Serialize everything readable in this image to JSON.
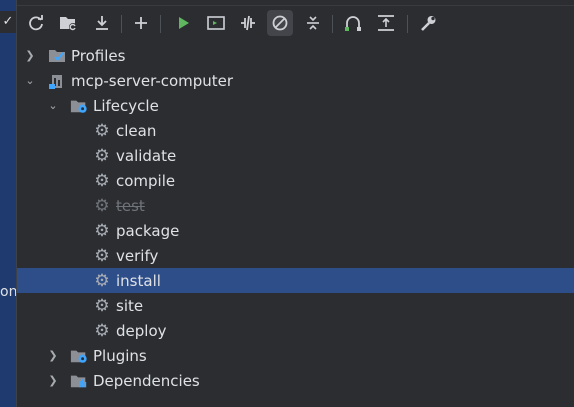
{
  "toolbar": {
    "buttons": [
      {
        "name": "reload-all-projects",
        "icon": "refresh-icon"
      },
      {
        "name": "generate-sources",
        "icon": "folder-refresh-icon"
      },
      {
        "name": "download-sources",
        "icon": "download-icon"
      },
      {
        "name": "add-maven-project",
        "icon": "plus-icon"
      },
      {
        "name": "run-maven-build",
        "icon": "run-icon"
      },
      {
        "name": "execute-maven-goal",
        "icon": "terminal-icon"
      },
      {
        "name": "toggle-offline-mode",
        "icon": "offline-icon"
      },
      {
        "name": "toggle-skip-tests",
        "icon": "skip-tests-icon"
      },
      {
        "name": "collapse-all",
        "icon": "collapse-icon"
      },
      {
        "name": "show-dependencies",
        "icon": "diagram-icon"
      },
      {
        "name": "expand-all",
        "icon": "expand-icon"
      },
      {
        "name": "maven-settings",
        "icon": "wrench-icon"
      }
    ]
  },
  "left": {
    "check": "✓",
    "text": "on"
  },
  "tree": {
    "profiles": "Profiles",
    "project": "mcp-server-computer",
    "lifecycle": "Lifecycle",
    "goals": [
      "clean",
      "validate",
      "compile",
      "test",
      "package",
      "verify",
      "install",
      "site",
      "deploy"
    ],
    "plugins": "Plugins",
    "dependencies": "Dependencies"
  },
  "colors": {
    "selection": "#2e4e8a",
    "run": "#5fb85f",
    "background": "#2b2d30"
  }
}
